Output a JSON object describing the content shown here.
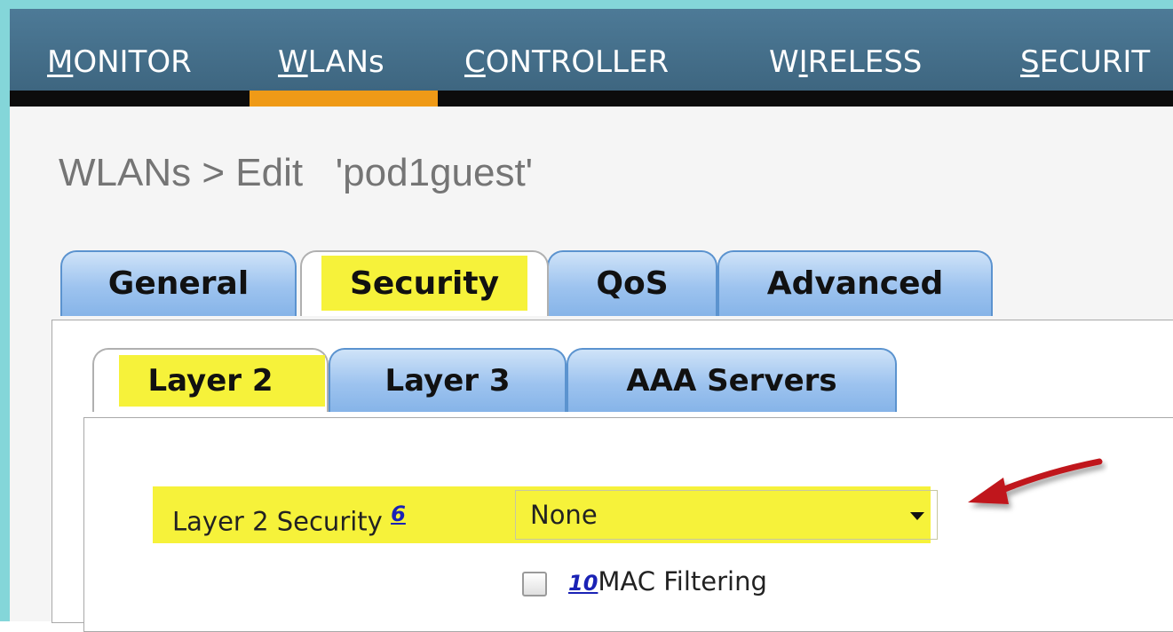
{
  "topnav": {
    "items": [
      {
        "accel": "M",
        "rest": "ONITOR"
      },
      {
        "accel": "W",
        "rest": "LANs"
      },
      {
        "accel": "C",
        "rest": "ONTROLLER"
      },
      {
        "pre": "W",
        "accel": "I",
        "rest": "RELESS"
      },
      {
        "accel": "S",
        "rest": "ECURIT"
      }
    ],
    "active": "WLANs"
  },
  "page_title": "WLANs > Edit   'pod1guest'",
  "tabs": [
    {
      "label": "General",
      "active": false
    },
    {
      "label": "Security",
      "active": true
    },
    {
      "label": "QoS",
      "active": false
    },
    {
      "label": "Advanced",
      "active": false
    }
  ],
  "subtabs": [
    {
      "label": "Layer 2",
      "active": true
    },
    {
      "label": "Layer 3",
      "active": false
    },
    {
      "label": "AAA Servers",
      "active": false
    }
  ],
  "layer2_security": {
    "label": "Layer 2 Security",
    "footnote": "6",
    "selected": "None"
  },
  "mac_filtering": {
    "footnote": "10",
    "label": "MAC Filtering",
    "checked": false
  },
  "colors": {
    "nav_bg": "#426c86",
    "nav_active": "#ef9a17",
    "highlight": "#f6f23a",
    "tab_blue": "#9dc3ef",
    "arrow": "#c0191c"
  }
}
